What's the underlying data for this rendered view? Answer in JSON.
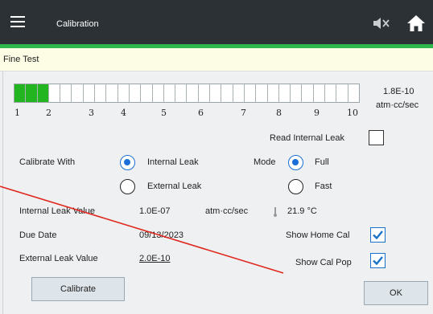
{
  "header": {
    "title": "Calibration",
    "accent_color": "#2db84d",
    "bg_color": "#2b3135"
  },
  "subheader": {
    "title": "Fine Test"
  },
  "leak_bar": {
    "ticks": [
      "1",
      "2",
      "3",
      "4",
      "5",
      "6",
      "7",
      "8",
      "9",
      "10"
    ],
    "segments_total": 30,
    "segments_filled": 3,
    "reading_value": "1.8E-10",
    "reading_unit": "atm·cc/sec",
    "fill_color": "#22b51f"
  },
  "options": {
    "read_internal_leak_label": "Read Internal Leak",
    "read_internal_leak_checked": false,
    "calibrate_with_label": "Calibrate With",
    "internal_leak_label": "Internal Leak",
    "external_leak_label": "External Leak",
    "calibrate_with_selected": "Internal Leak",
    "mode_label": "Mode",
    "mode_full_label": "Full",
    "mode_fast_label": "Fast",
    "mode_selected": "Full"
  },
  "values": {
    "internal_leak_value_label": "Internal Leak Value",
    "internal_leak_value": "1.0E-07",
    "internal_leak_unit": "atm·cc/sec",
    "temperature": "21.9 °C",
    "due_date_label": "Due Date",
    "due_date": "09/13/2023",
    "external_leak_value_label": "External Leak Value",
    "external_leak_value": "2.0E-10",
    "show_home_cal_label": "Show Home Cal",
    "show_home_cal_checked": true,
    "show_cal_pop_label": "Show Cal Pop",
    "show_cal_pop_checked": true
  },
  "buttons": {
    "calibrate_label": "Calibrate",
    "ok_label": "OK"
  },
  "icons": {
    "menu": "hamburger-menu-icon",
    "mute": "speaker-muted-icon",
    "home": "home-icon",
    "thermometer": "thermometer-icon"
  }
}
